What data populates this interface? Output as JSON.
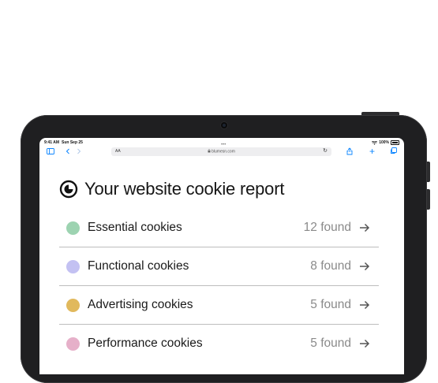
{
  "status_bar": {
    "time": "9:41 AM",
    "date": "Sun Sep 25",
    "battery": "100%"
  },
  "browser": {
    "text_size_label": "AA",
    "url": "blumesn.com"
  },
  "page": {
    "title": "Your website cookie report",
    "rows": [
      {
        "label": "Essential cookies",
        "count": "12 found",
        "color": "#9dd3b1"
      },
      {
        "label": "Functional cookies",
        "count": "8 found",
        "color": "#c3c1f2"
      },
      {
        "label": "Advertising cookies",
        "count": "5 found",
        "color": "#e1b95d"
      },
      {
        "label": "Performance cookies",
        "count": "5 found",
        "color": "#e6b0c9"
      }
    ]
  }
}
